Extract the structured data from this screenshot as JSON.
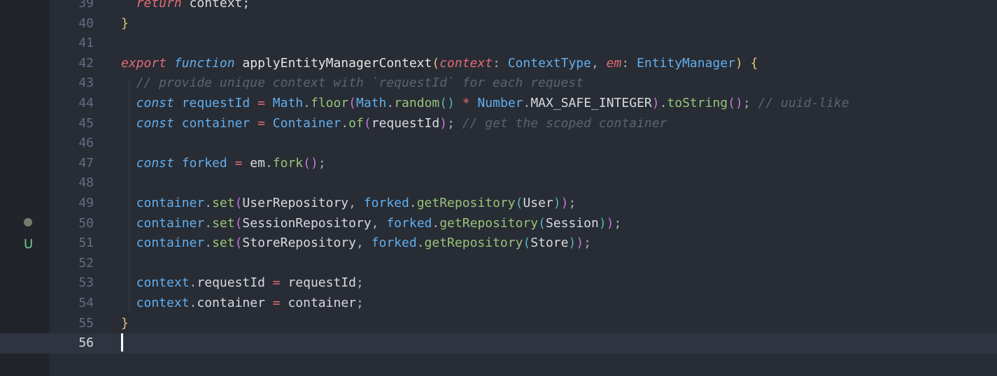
{
  "editor": {
    "language": "TypeScript",
    "current_line": "56",
    "git_markers": {
      "modified_line": "50",
      "untracked_label": "U"
    },
    "colors": {
      "background": "#282c34",
      "activity_bar": "#21252b",
      "line_number": "#636d83",
      "current_line_bg": "#2f3540",
      "keyword": "#e06c75",
      "function_keyword": "#61afef",
      "method": "#98c379",
      "comment": "#5c6370",
      "untracked": "#73c991"
    }
  },
  "lines": [
    {
      "num": "39",
      "tokens": [
        {
          "c": "kw",
          "t": "  return"
        },
        {
          "c": "plain",
          "t": " context;"
        }
      ]
    },
    {
      "num": "40",
      "tokens": [
        {
          "c": "brace",
          "t": "}"
        }
      ]
    },
    {
      "num": "41",
      "tokens": []
    },
    {
      "num": "42",
      "tokens": [
        {
          "c": "kw",
          "t": "export"
        },
        {
          "c": "plain",
          "t": " "
        },
        {
          "c": "kw2",
          "t": "function"
        },
        {
          "c": "plain",
          "t": " "
        },
        {
          "c": "fn",
          "t": "applyEntityManagerContext"
        },
        {
          "c": "paren1",
          "t": "("
        },
        {
          "c": "param",
          "t": "context"
        },
        {
          "c": "punct",
          "t": ": "
        },
        {
          "c": "type",
          "t": "ContextType"
        },
        {
          "c": "punct",
          "t": ", "
        },
        {
          "c": "param",
          "t": "em"
        },
        {
          "c": "punct",
          "t": ": "
        },
        {
          "c": "type",
          "t": "EntityManager"
        },
        {
          "c": "paren1",
          "t": ")"
        },
        {
          "c": "plain",
          "t": " "
        },
        {
          "c": "brace",
          "t": "{"
        }
      ]
    },
    {
      "num": "43",
      "tokens": [
        {
          "c": "cmt",
          "t": "  // provide unique context with `requestId` for each request"
        }
      ]
    },
    {
      "num": "44",
      "tokens": [
        {
          "c": "kw2",
          "t": "  const"
        },
        {
          "c": "plain",
          "t": " "
        },
        {
          "c": "var",
          "t": "requestId"
        },
        {
          "c": "plain",
          "t": " "
        },
        {
          "c": "op",
          "t": "="
        },
        {
          "c": "plain",
          "t": " "
        },
        {
          "c": "type",
          "t": "Math"
        },
        {
          "c": "punct",
          "t": "."
        },
        {
          "c": "fn-green",
          "t": "floor"
        },
        {
          "c": "paren2",
          "t": "("
        },
        {
          "c": "type",
          "t": "Math"
        },
        {
          "c": "punct",
          "t": "."
        },
        {
          "c": "fn-green",
          "t": "random"
        },
        {
          "c": "paren3",
          "t": "()"
        },
        {
          "c": "plain",
          "t": " "
        },
        {
          "c": "op",
          "t": "*"
        },
        {
          "c": "plain",
          "t": " "
        },
        {
          "c": "type",
          "t": "Number"
        },
        {
          "c": "punct",
          "t": "."
        },
        {
          "c": "plain",
          "t": "MAX_SAFE_INTEGER"
        },
        {
          "c": "paren2",
          "t": ")"
        },
        {
          "c": "punct",
          "t": "."
        },
        {
          "c": "fn-green",
          "t": "toString"
        },
        {
          "c": "paren2",
          "t": "()"
        },
        {
          "c": "punct",
          "t": ";"
        },
        {
          "c": "plain",
          "t": " "
        },
        {
          "c": "cmt",
          "t": "// uuid-like"
        }
      ]
    },
    {
      "num": "45",
      "tokens": [
        {
          "c": "kw2",
          "t": "  const"
        },
        {
          "c": "plain",
          "t": " "
        },
        {
          "c": "var",
          "t": "container"
        },
        {
          "c": "plain",
          "t": " "
        },
        {
          "c": "op",
          "t": "="
        },
        {
          "c": "plain",
          "t": " "
        },
        {
          "c": "type",
          "t": "Container"
        },
        {
          "c": "punct",
          "t": "."
        },
        {
          "c": "fn-green",
          "t": "of"
        },
        {
          "c": "paren2",
          "t": "("
        },
        {
          "c": "plain",
          "t": "requestId"
        },
        {
          "c": "paren2",
          "t": ")"
        },
        {
          "c": "punct",
          "t": ";"
        },
        {
          "c": "plain",
          "t": " "
        },
        {
          "c": "cmt",
          "t": "// get the scoped container"
        }
      ]
    },
    {
      "num": "46",
      "tokens": []
    },
    {
      "num": "47",
      "tokens": [
        {
          "c": "kw2",
          "t": "  const"
        },
        {
          "c": "plain",
          "t": " "
        },
        {
          "c": "var",
          "t": "forked"
        },
        {
          "c": "plain",
          "t": " "
        },
        {
          "c": "op",
          "t": "="
        },
        {
          "c": "plain",
          "t": " "
        },
        {
          "c": "plain",
          "t": "em"
        },
        {
          "c": "punct",
          "t": "."
        },
        {
          "c": "fn-green",
          "t": "fork"
        },
        {
          "c": "paren2",
          "t": "()"
        },
        {
          "c": "punct",
          "t": ";"
        }
      ]
    },
    {
      "num": "48",
      "tokens": []
    },
    {
      "num": "49",
      "tokens": [
        {
          "c": "var",
          "t": "  container"
        },
        {
          "c": "punct",
          "t": "."
        },
        {
          "c": "fn-green",
          "t": "set"
        },
        {
          "c": "paren2",
          "t": "("
        },
        {
          "c": "plain",
          "t": "UserRepository"
        },
        {
          "c": "punct",
          "t": ", "
        },
        {
          "c": "var",
          "t": "forked"
        },
        {
          "c": "punct",
          "t": "."
        },
        {
          "c": "fn-green",
          "t": "getRepository"
        },
        {
          "c": "paren3",
          "t": "("
        },
        {
          "c": "plain",
          "t": "User"
        },
        {
          "c": "paren3",
          "t": ")"
        },
        {
          "c": "paren2",
          "t": ")"
        },
        {
          "c": "punct",
          "t": ";"
        }
      ]
    },
    {
      "num": "50",
      "tokens": [
        {
          "c": "var",
          "t": "  container"
        },
        {
          "c": "punct",
          "t": "."
        },
        {
          "c": "fn-green",
          "t": "set"
        },
        {
          "c": "paren2",
          "t": "("
        },
        {
          "c": "plain",
          "t": "SessionRepository"
        },
        {
          "c": "punct",
          "t": ", "
        },
        {
          "c": "var",
          "t": "forked"
        },
        {
          "c": "punct",
          "t": "."
        },
        {
          "c": "fn-green",
          "t": "getRepository"
        },
        {
          "c": "paren3",
          "t": "("
        },
        {
          "c": "plain",
          "t": "Session"
        },
        {
          "c": "paren3",
          "t": ")"
        },
        {
          "c": "paren2",
          "t": ")"
        },
        {
          "c": "punct",
          "t": ";"
        }
      ]
    },
    {
      "num": "51",
      "tokens": [
        {
          "c": "var",
          "t": "  container"
        },
        {
          "c": "punct",
          "t": "."
        },
        {
          "c": "fn-green",
          "t": "set"
        },
        {
          "c": "paren2",
          "t": "("
        },
        {
          "c": "plain",
          "t": "StoreRepository"
        },
        {
          "c": "punct",
          "t": ", "
        },
        {
          "c": "var",
          "t": "forked"
        },
        {
          "c": "punct",
          "t": "."
        },
        {
          "c": "fn-green",
          "t": "getRepository"
        },
        {
          "c": "paren3",
          "t": "("
        },
        {
          "c": "plain",
          "t": "Store"
        },
        {
          "c": "paren3",
          "t": ")"
        },
        {
          "c": "paren2",
          "t": ")"
        },
        {
          "c": "punct",
          "t": ";"
        }
      ]
    },
    {
      "num": "52",
      "tokens": []
    },
    {
      "num": "53",
      "tokens": [
        {
          "c": "var",
          "t": "  context"
        },
        {
          "c": "punct",
          "t": "."
        },
        {
          "c": "plain",
          "t": "requestId"
        },
        {
          "c": "plain",
          "t": " "
        },
        {
          "c": "op",
          "t": "="
        },
        {
          "c": "plain",
          "t": " requestId"
        },
        {
          "c": "punct",
          "t": ";"
        }
      ]
    },
    {
      "num": "54",
      "tokens": [
        {
          "c": "var",
          "t": "  context"
        },
        {
          "c": "punct",
          "t": "."
        },
        {
          "c": "plain",
          "t": "container"
        },
        {
          "c": "plain",
          "t": " "
        },
        {
          "c": "op",
          "t": "="
        },
        {
          "c": "plain",
          "t": " container"
        },
        {
          "c": "punct",
          "t": ";"
        }
      ]
    },
    {
      "num": "55",
      "tokens": [
        {
          "c": "brace",
          "t": "}"
        }
      ]
    },
    {
      "num": "56",
      "tokens": []
    }
  ]
}
